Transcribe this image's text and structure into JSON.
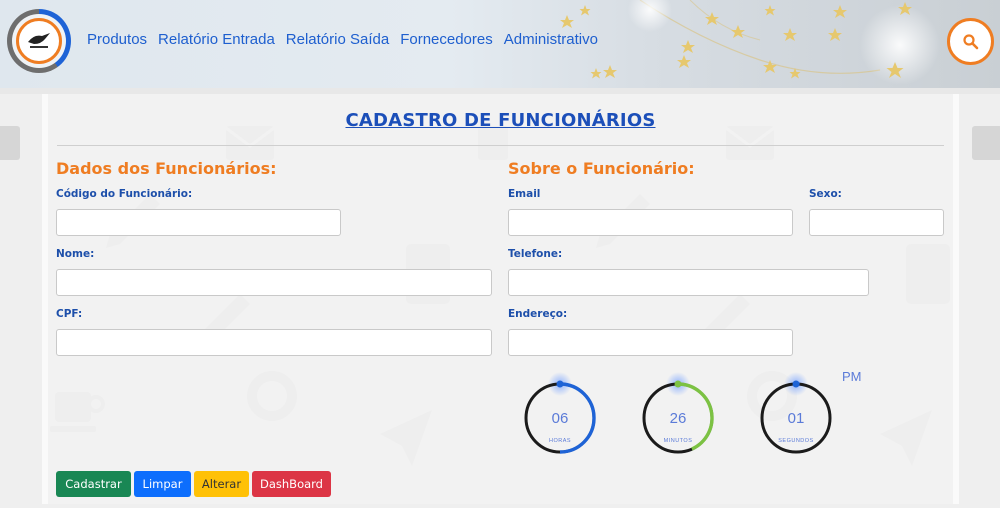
{
  "header": {
    "nav": [
      "Produtos",
      "Relatório Entrada",
      "Relatório Saída",
      "Fornecedores",
      "Administrativo"
    ]
  },
  "page": {
    "title": "CADASTRO DE FUNCIONÁRIOS"
  },
  "left_section": {
    "title": "Dados dos Funcionários:",
    "fields": {
      "codigo": {
        "label": "Código do Funcionário:",
        "value": ""
      },
      "nome": {
        "label": "Nome:",
        "value": ""
      },
      "cpf": {
        "label": "CPF:",
        "value": ""
      }
    }
  },
  "right_section": {
    "title": "Sobre o Funcionário:",
    "fields": {
      "email": {
        "label": "Email",
        "value": ""
      },
      "sexo": {
        "label": "Sexo:",
        "value": ""
      },
      "telefone": {
        "label": "Telefone:",
        "value": ""
      },
      "endereco": {
        "label": "Endereço:",
        "value": ""
      }
    }
  },
  "clock": {
    "ampm": "PM",
    "hours": {
      "value": "06",
      "label": "HORAS",
      "fraction": 0.5,
      "color": "#1e63d6"
    },
    "minutes": {
      "value": "26",
      "label": "MINUTOS",
      "fraction": 0.433,
      "color": "#7cc243"
    },
    "seconds": {
      "value": "01",
      "label": "SEGUNDOS",
      "fraction": 0.017,
      "color": "#1e63d6"
    }
  },
  "buttons": {
    "cadastrar": "Cadastrar",
    "limpar": "Limpar",
    "alterar": "Alterar",
    "dashboard": "DashBoard"
  },
  "colors": {
    "accent_orange": "#ef7d22",
    "title_blue": "#1c4fb9",
    "link_blue": "#1e5fcf"
  }
}
